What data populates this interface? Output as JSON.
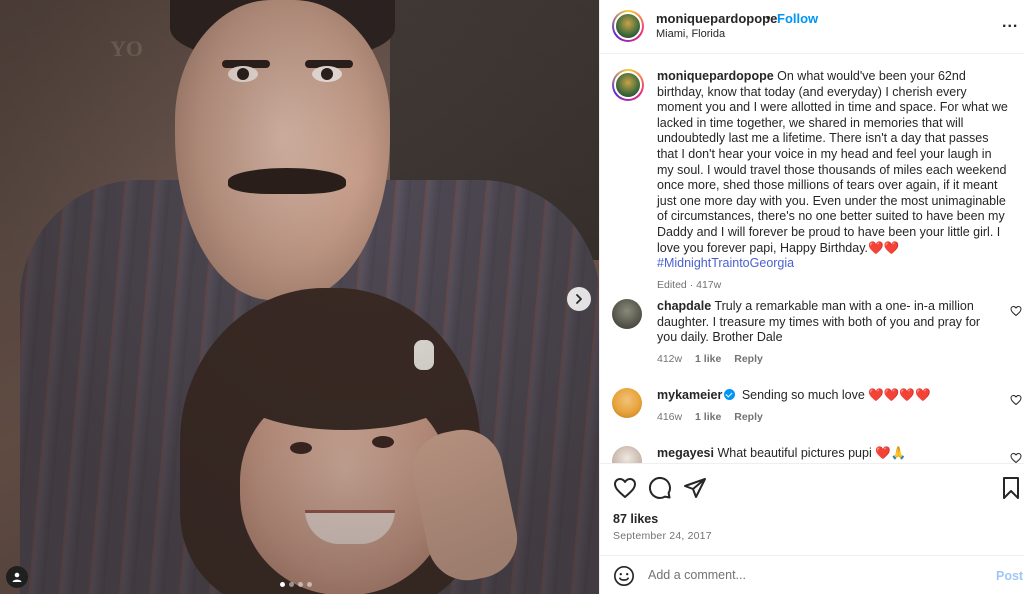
{
  "post": {
    "image_alt_icons": {
      "next": "chevron-right-icon",
      "tag": "user-tag-icon"
    },
    "carousel": {
      "count": 4,
      "active_index": 0
    }
  },
  "header": {
    "username": "moniquepardopope",
    "separator": "•",
    "follow_label": "Follow",
    "location": "Miami, Florida",
    "more_label": "..."
  },
  "caption": {
    "username": "moniquepardopope",
    "text": "On what would've been your 62nd birthday, know that today (and everyday) I cherish every moment you and I were allotted in time and space. For what we lacked in time together, we shared in memories that will undoubtedly last me a lifetime. There isn't a day that passes that I don't hear your voice in my head and feel your laugh in my soul. I would travel those thousands of miles each weekend once more, shed those millions of tears over again, if it meant just one more day with you. Even under the most unimaginable of circumstances, there's no one better suited to have been my Daddy and I will forever be proud to have been your little girl. I love you forever papi, Happy Birthday.",
    "emoji": "❤️❤️",
    "hashtag": "#MidnightTraintoGeorgia",
    "edited_label": "Edited",
    "meta_separator": "·",
    "age": "417w"
  },
  "comments": [
    {
      "username": "chapdale",
      "text": "Truly a remarkable man with a one- in-a million daughter. I treasure my times with both of you and pray for you daily. Brother Dale",
      "age": "412w",
      "likes": "1 like",
      "reply_label": "Reply",
      "verified": false
    },
    {
      "username": "mykameier",
      "text": "Sending so much love ❤️❤️❤️❤️",
      "age": "416w",
      "likes": "1 like",
      "reply_label": "Reply",
      "verified": true
    },
    {
      "username": "megayesi",
      "text": "What beautiful pictures pupi ❤️🙏",
      "age": "",
      "likes": "",
      "reply_label": "",
      "verified": false
    }
  ],
  "actions": {
    "like_icon": "heart-icon",
    "comment_icon": "comment-icon",
    "share_icon": "paper-plane-icon",
    "save_icon": "bookmark-icon",
    "likes_count": "87 likes",
    "date": "September 24, 2017"
  },
  "add_comment": {
    "placeholder": "Add a comment...",
    "post_label": "Post"
  },
  "colors": {
    "accent": "#0095f6",
    "hashtag": "#4a5fd0",
    "muted": "#737373",
    "post_disabled": "#9fc7f5",
    "heart": "#ed4956"
  }
}
